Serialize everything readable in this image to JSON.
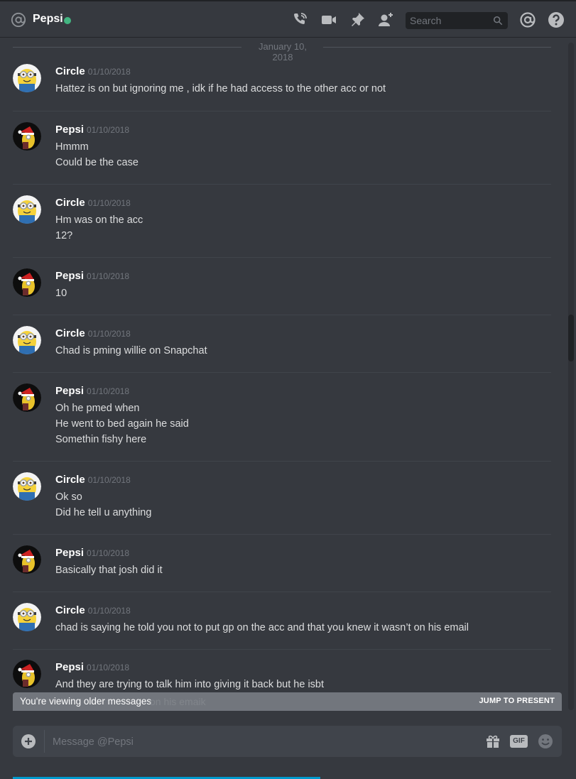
{
  "header": {
    "channel_name": "Pepsi",
    "status_color": "#43b581",
    "icons": [
      "at-icon",
      "call-icon",
      "video-icon",
      "pin-icon",
      "add-friend-icon",
      "mention-icon",
      "help-icon"
    ],
    "search_placeholder": "Search"
  },
  "chat": {
    "date_divider": "January 10, 2018",
    "messages": [
      {
        "author": "Circle",
        "timestamp": "01/10/2018",
        "lines": [
          "Hattez is on but ignoring me , idk if he had access to the other acc or not"
        ]
      },
      {
        "author": "Pepsi",
        "timestamp": "01/10/2018",
        "lines": [
          "Hmmm",
          "Could be the case"
        ]
      },
      {
        "author": "Circle",
        "timestamp": "01/10/2018",
        "lines": [
          "Hm was on the acc",
          "12?"
        ]
      },
      {
        "author": "Pepsi",
        "timestamp": "01/10/2018",
        "lines": [
          "10"
        ]
      },
      {
        "author": "Circle",
        "timestamp": "01/10/2018",
        "lines": [
          "Chad is pming willie on Snapchat"
        ]
      },
      {
        "author": "Pepsi",
        "timestamp": "01/10/2018",
        "lines": [
          "Oh he pmed when",
          "He went to bed again he said",
          "Somethin fishy here"
        ]
      },
      {
        "author": "Circle",
        "timestamp": "01/10/2018",
        "lines": [
          "Ok so",
          "Did he tell u anything"
        ]
      },
      {
        "author": "Pepsi",
        "timestamp": "01/10/2018",
        "lines": [
          "Basically that josh did it"
        ]
      },
      {
        "author": "Circle",
        "timestamp": "01/10/2018",
        "lines": [
          "chad is saying he told you not to put gp on the acc and that you knew it wasn’t on his email"
        ]
      },
      {
        "author": "Pepsi",
        "timestamp": "01/10/2018",
        "lines": [
          "And they are trying to talk him into giving it back but he isbt",
          "on his emaik"
        ]
      }
    ]
  },
  "older_bar": {
    "text": "You're viewing older messages",
    "jump_label": "JUMP TO PRESENT"
  },
  "composer": {
    "placeholder": "Message @Pepsi",
    "gif_label": "GIF",
    "icons": [
      "add-icon",
      "gift-icon",
      "gif-icon",
      "emoji-icon"
    ]
  },
  "colors": {
    "background": "#36393f",
    "accent_online": "#43b581",
    "older_bar": "#72767d"
  }
}
